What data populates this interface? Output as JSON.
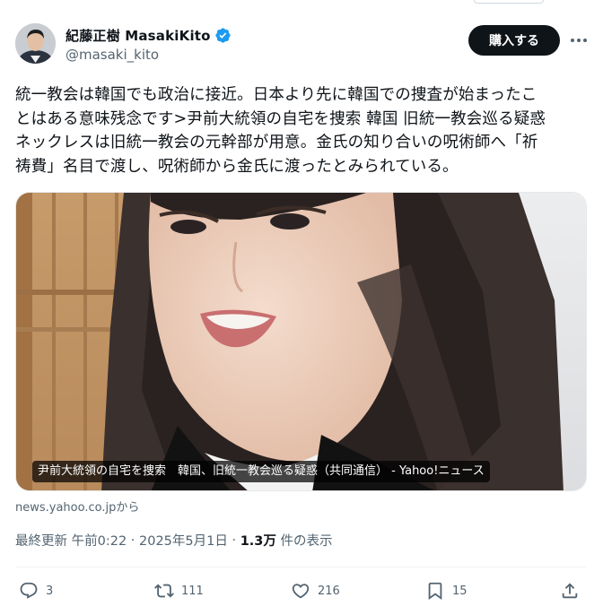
{
  "author": {
    "display_name": "紀藤正樹 MasakiKito",
    "handle": "@masaki_kito",
    "verified": true,
    "verified_color": "#1d9bf0"
  },
  "buy_button_label": "購入する",
  "tweet_text": "統一教会は韓国でも政治に接近。日本より先に韓国での捜査が始まったこ\nとはある意味残念です>尹前大統領の自宅を捜索 韓国 旧統一教会巡る疑惑\nネックレスは旧統一教会の元幹部が用意。金氏の知り合いの呪術師へ「祈\n祷費」名目で渡し、呪術師から金氏に渡ったとみられている。",
  "card": {
    "caption": "尹前大統領の自宅を捜索　韓国、旧統一教会巡る疑惑（共同通信） - Yahoo!ニュース",
    "source": "news.yahoo.co.jpから"
  },
  "meta": {
    "time": "最終更新 午前0:22",
    "date": "2025年5月1日",
    "views_count": "1.3万",
    "views_label": "件の表示",
    "separator": " · "
  },
  "actions": {
    "replies": "3",
    "reposts": "111",
    "likes": "216",
    "bookmarks": "15"
  },
  "icons": [
    "reply-icon",
    "repost-icon",
    "like-icon",
    "bookmark-icon",
    "share-icon",
    "verified-badge-icon",
    "more-icon"
  ],
  "colors": {
    "text": "#0f1419",
    "secondary": "#536471",
    "button_bg": "#0f1419"
  }
}
